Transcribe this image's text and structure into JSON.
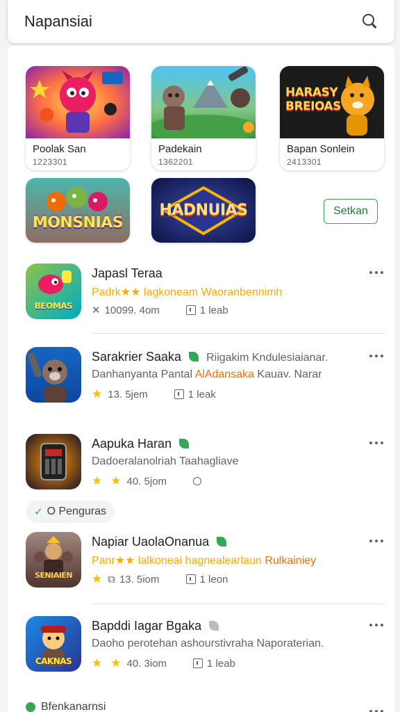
{
  "header": {
    "title": "Napansiai",
    "search_icon": "search-icon"
  },
  "featured": [
    {
      "name": "Poolak San",
      "id": "1223301"
    },
    {
      "name": "Padekain",
      "id": "1362201"
    },
    {
      "name": "Bapan Sonlein",
      "id": "2413301"
    }
  ],
  "banners": [
    {
      "logo": "MONSNIAS"
    },
    {
      "logo": "HADNUIAS"
    }
  ],
  "feature_art_text": {
    "card3": "HARASY BREIOAS"
  },
  "see_more_label": "Setkan",
  "apps": [
    {
      "title": "Japasl Teraa",
      "subtitle": "Padrk★★ lagkoneam Waoranbennimh",
      "subtitle_color": "#f9ab00",
      "rating": "10099. 4om",
      "size": "1 leab",
      "icon_text": "BEOMAS",
      "verified": false
    },
    {
      "title": "Sarakrier Saaka",
      "title_extra": "Riigakim Kndulesiaianar.",
      "subtitle_prefix": "Danhanyanta Pantal",
      "subtitle_highlight": "AlAdansaka",
      "subtitle_suffix": "Kauav. Narar",
      "rating": "13. 5jem",
      "size": "1 leak",
      "verified": true
    },
    {
      "title": "Aapuka Haran",
      "subtitle": "Dadoeralanolriah Taahagliave",
      "subtitle_color": "#5f6368",
      "rating": "40. 5jom",
      "size": "",
      "verified": true
    },
    {
      "title": "Napiar UaolaOnanua",
      "subtitle_prefix": "Panr★★ lalkoneai",
      "subtitle_mid": "hagnealearlaun",
      "subtitle_suffix": "Rulkainiey",
      "subtitle_color": "#f9ab00",
      "rating": "13. 5iom",
      "size": "1 leon",
      "icon_text": "SENIAIEN",
      "verified": true
    },
    {
      "title": "Bapddi Iagar Bgaka",
      "subtitle": "Daoho perotehan ashourstivraha Naporaterian.",
      "subtitle_color": "#5f6368",
      "rating": "40. 3iom",
      "size": "1 leab",
      "icon_text": "CAKNAS",
      "verified": true
    }
  ],
  "chip": {
    "check": "✓",
    "label": "O Penguras"
  },
  "footer": {
    "label": "Bfenkanarnsi"
  },
  "colors": {
    "accent": "#34a853",
    "star": "#fbbc04",
    "orange": "#e8710a"
  }
}
